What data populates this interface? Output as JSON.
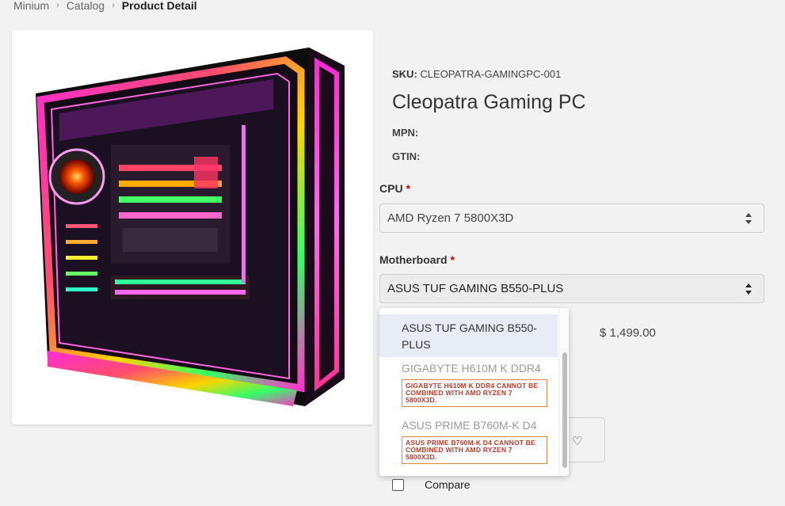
{
  "breadcrumb": {
    "items": [
      "Minium",
      "Catalog"
    ],
    "current": "Product Detail"
  },
  "product": {
    "sku_label": "SKU:",
    "sku_value": "CLEOPATRA-GAMINGPC-001",
    "title": "Cleopatra Gaming PC",
    "mpn_label": "MPN:",
    "gtin_label": "GTIN:",
    "price": "$ 1,499.00"
  },
  "cpu": {
    "label": "CPU",
    "required": "*",
    "value": "AMD Ryzen 7 5800X3D"
  },
  "motherboard": {
    "label": "Motherboard",
    "required": "*",
    "value": "ASUS TUF GAMING B550-PLUS",
    "options": [
      {
        "label": "ASUS TUF GAMING B550-PLUS",
        "error": ""
      },
      {
        "label": "GIGABYTE H610M K DDR4",
        "error": "GIGABYTE H610M K DDR4 CANNOT BE COMBINED WITH AMD RYZEN 7 5800X3D."
      },
      {
        "label": "ASUS PRIME B760M-K D4",
        "error": "ASUS PRIME B760M-K D4 CANNOT BE COMBINED WITH AMD RYZEN 7 5800X3D."
      }
    ]
  },
  "compare": {
    "label": "Compare"
  },
  "icons": {
    "wishlist": "heart-icon",
    "separator": "chevron-right-icon",
    "select": "sort-arrows-icon"
  }
}
